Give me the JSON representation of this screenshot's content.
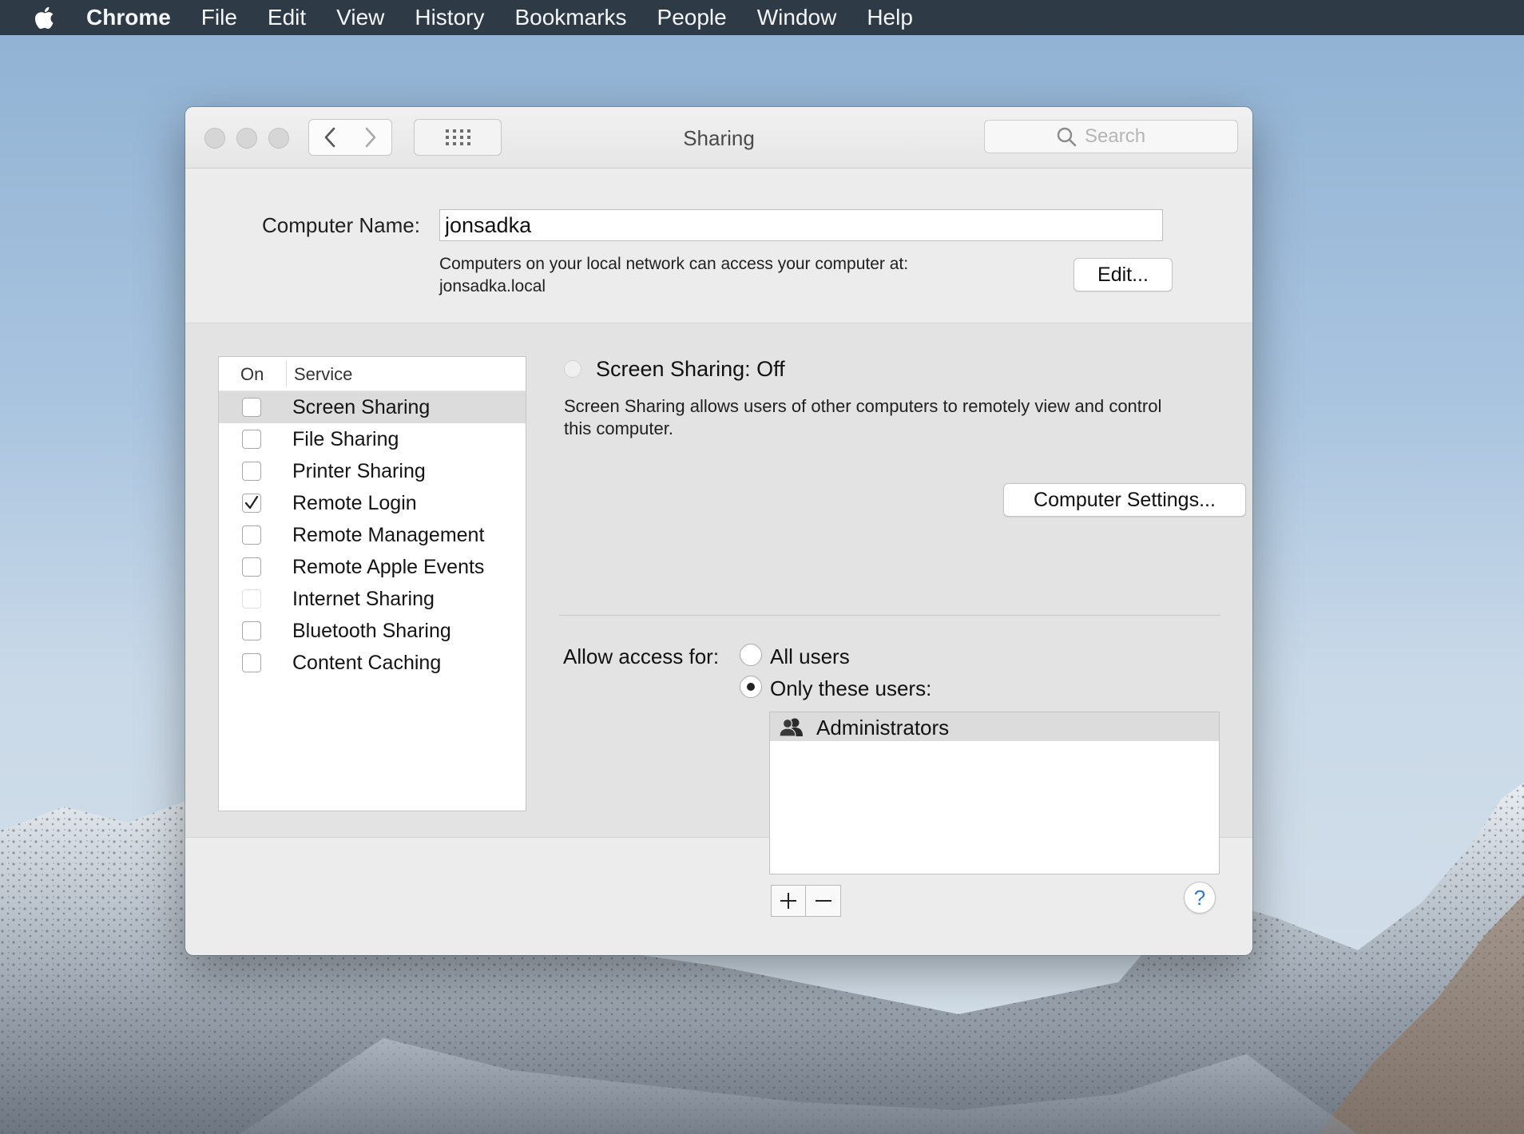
{
  "menubar": {
    "app_name": "Chrome",
    "items": [
      "File",
      "Edit",
      "View",
      "History",
      "Bookmarks",
      "People",
      "Window",
      "Help"
    ]
  },
  "window": {
    "title": "Sharing",
    "search_placeholder": "Search"
  },
  "computer_name": {
    "label": "Computer Name:",
    "value": "jonsadka",
    "description_line1": "Computers on your local network can access your computer at:",
    "description_line2": "jonsadka.local",
    "edit_button": "Edit..."
  },
  "services": {
    "header_on": "On",
    "header_service": "Service",
    "items": [
      {
        "label": "Screen Sharing",
        "checked": false,
        "selected": true
      },
      {
        "label": "File Sharing",
        "checked": false
      },
      {
        "label": "Printer Sharing",
        "checked": false
      },
      {
        "label": "Remote Login",
        "checked": true
      },
      {
        "label": "Remote Management",
        "checked": false
      },
      {
        "label": "Remote Apple Events",
        "checked": false
      },
      {
        "label": "Internet Sharing",
        "checked": false,
        "disabled": true
      },
      {
        "label": "Bluetooth Sharing",
        "checked": false
      },
      {
        "label": "Content Caching",
        "checked": false
      }
    ]
  },
  "detail": {
    "status_title": "Screen Sharing: Off",
    "description_line1": "Screen Sharing allows users of other computers to remotely view and control",
    "description_line2": "this computer.",
    "computer_settings_button": "Computer Settings...",
    "access_label": "Allow access for:",
    "option_all": "All users",
    "option_only": "Only these users:",
    "selected_option": "only",
    "users": [
      "Administrators"
    ],
    "add_symbol": "+",
    "remove_symbol": "−"
  },
  "help_symbol": "?"
}
